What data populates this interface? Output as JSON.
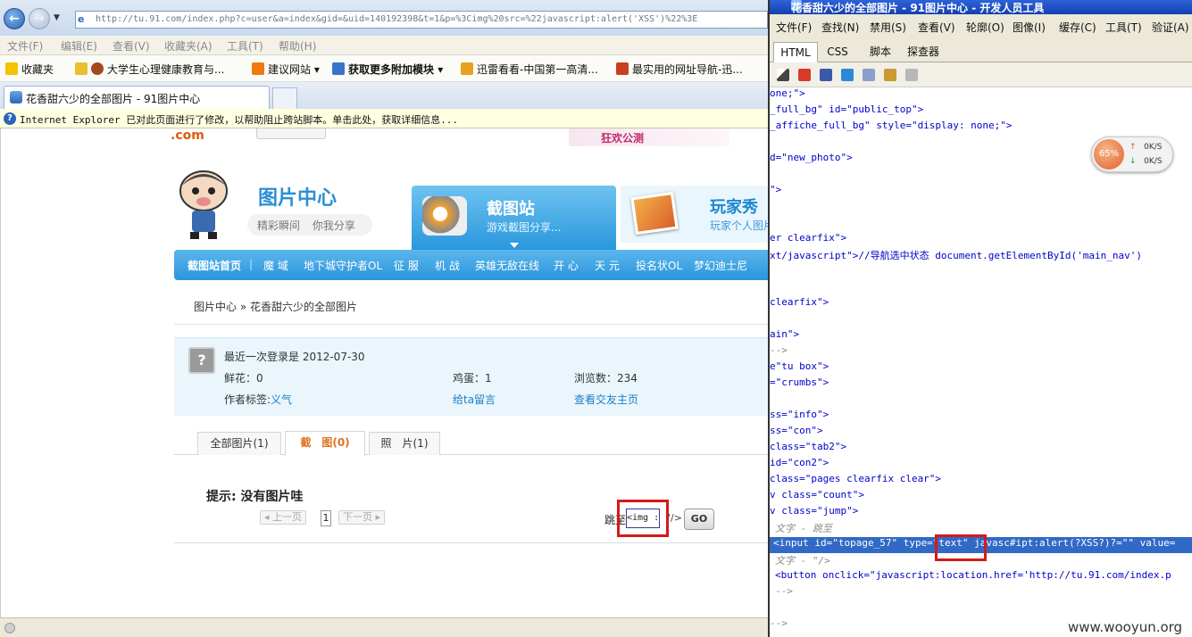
{
  "ie": {
    "url": "http://tu.91.com/index.php?c=user&a=index&gid=&uid=140192398&t=1&p=%3Cimg%20src=%22javascript:alert('XSS')%22%3E",
    "menu": [
      "文件(F)",
      "编辑(E)",
      "查看(V)",
      "收藏夹(A)",
      "工具(T)",
      "帮助(H)"
    ],
    "favorites": {
      "label": "收藏夹",
      "items": [
        "大学生心理健康教育与...",
        "建议网站",
        "获取更多附加模块",
        "迅雷看看-中国第一高清...",
        "最实用的网址导航-迅..."
      ]
    },
    "tab_title": "花香甜六少的全部图片 - 91图片中心",
    "infobar": "Internet Explorer 已对此页面进行了修改，以帮助阻止跨站脚本。单击此处，获取详细信息..."
  },
  "page": {
    "logo_text": ".com",
    "banner_ad": "狂欢公测",
    "site_title": "图片中心",
    "site_subtitle": "精彩瞬间 你我分享",
    "card1": {
      "title": "截图站",
      "subtitle": "游戏截图分享..."
    },
    "card2": {
      "title": "玩家秀",
      "subtitle": "玩家个人图片"
    },
    "nav": [
      "截图站首页",
      "魔 域",
      "地下城守护者OL",
      "征 服",
      "机 战",
      "英雄无敌在线",
      "开 心",
      "天 元",
      "投名状OL",
      "梦幻迪士尼"
    ],
    "breadcrumb": "图片中心 » 花香甜六少的全部图片",
    "info": {
      "last_login": "最近一次登录是 2012-07-30",
      "flowers": "鲜花：0",
      "eggs": "鸡蛋：1",
      "views": "浏览数：234",
      "tag_label": "作者标签:",
      "tag_value": "义气",
      "message_link": "给ta留言",
      "home_link": "查看交友主页"
    },
    "tabs": [
      "全部图片(1)",
      "截　图(0)",
      "照　片(1)"
    ],
    "hint": "提示: 没有图片哇",
    "pager": {
      "prev": "上一页",
      "page": "1",
      "next": "下一页"
    },
    "jump_label": "跳至",
    "jump_value": "<img :",
    "jump_tail": "\"/>",
    "go": "GO"
  },
  "devtools": {
    "title": "花香甜六少的全部图片 - 91图片中心 - 开发人员工具",
    "menu": [
      "文件(F)",
      "查找(N)",
      "禁用(S)",
      "查看(V)",
      "轮廓(O)",
      "图像(I)",
      "缓存(C)",
      "工具(T)",
      "验证(A)"
    ],
    "tabs": [
      "HTML",
      "CSS",
      "脚本",
      "探查器"
    ],
    "lines": [
      "one;\">",
      "_full_bg\" id=\"public_top\">",
      "_affiche_full_bg\" style=\"display: none;\">",
      "",
      "d=\"new_photo\">",
      "",
      "\">",
      "",
      "",
      "er clearfix\">",
      "xt/javascript\">//导航选中状态    document.getElementById('main_nav')",
      "",
      "",
      " clearfix\">",
      "",
      "ain\">",
      "-->",
      "e\"tu box\">",
      "=\"crumbs\">",
      "",
      "ss=\"info\">",
      "ss=\"con\">",
      "class=\"tab2\">",
      "id=\"con2\">",
      "class=\"pages clearfix clear\">",
      "v class=\"count\">",
      "v class=\"jump\">",
      "文字 - 跳至",
      "<input id=\"topage_57\" type=\"text\" javasc#ipt:alert(?XSS?)?=\"\" value=",
      "文字 - \"/>",
      "<button onclick=\"javascript:location.href='http://tu.91.com/index.p",
      "-->",
      "",
      "-->"
    ]
  },
  "net": {
    "percent": "65%",
    "up": "0K/S",
    "down": "0K/S"
  },
  "watermark": "www.wooyun.org"
}
